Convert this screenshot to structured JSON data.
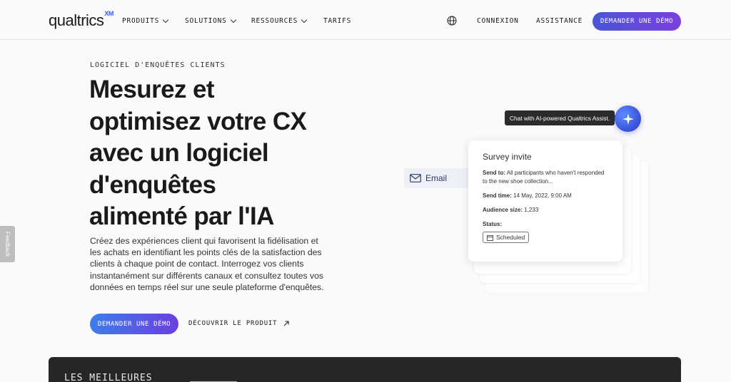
{
  "nav": {
    "logo": "qualtrics",
    "logo_sup": "XM",
    "items": [
      {
        "label": "PRODUITS",
        "has_menu": true
      },
      {
        "label": "SOLUTIONS",
        "has_menu": true
      },
      {
        "label": "RESSOURCES",
        "has_menu": true
      },
      {
        "label": "TARIFS",
        "has_menu": false
      }
    ],
    "language_icon": "globe-icon",
    "login": "CONNEXION",
    "support": "ASSISTANCE",
    "demo": "DEMANDER UNE DÉMO"
  },
  "hero": {
    "eyebrow": "LOGICIEL D'ENQUÊTES CLIENTS",
    "headline": "Mesurez et\noptimisez votre CX\navec un logiciel\nd'enquêtes\nalimenté par l'IA",
    "description": "Créez des expériences client qui favorisent la fidélisation et les achats en identifiant les points clés de la satisfaction des clients à chaque point de contact. Interrogez vos clients instantanément sur différents canaux et consultez toutes vos données en temps réel sur une seule plateforme d'enquêtes.",
    "cta": "DEMANDER UNE DÉMO",
    "link": "DÉCOUVRIR LE PRODUIT"
  },
  "feedback": "Feedback",
  "illustration": {
    "channel": "Email",
    "card_title": "Survey invite",
    "send_to_label": "Send to:",
    "send_to_value": "All participants who haven't responded to the new shoe collection...",
    "send_time_label": "Send time:",
    "send_time_value": "14 May, 2022, 9:00 AM",
    "audience_label": "Audience size:",
    "audience_value": "1,233",
    "status_label": "Status:",
    "status_value": "Scheduled"
  },
  "assist_tooltip": "Chat with AI-powered Qualtrics Assist.",
  "bottom": {
    "title": "LES MEILLEURES"
  },
  "colors": {
    "accent_gradient_start": "#4a55d6",
    "accent_gradient_end": "#7a3fe0",
    "dark_section": "#262626"
  }
}
